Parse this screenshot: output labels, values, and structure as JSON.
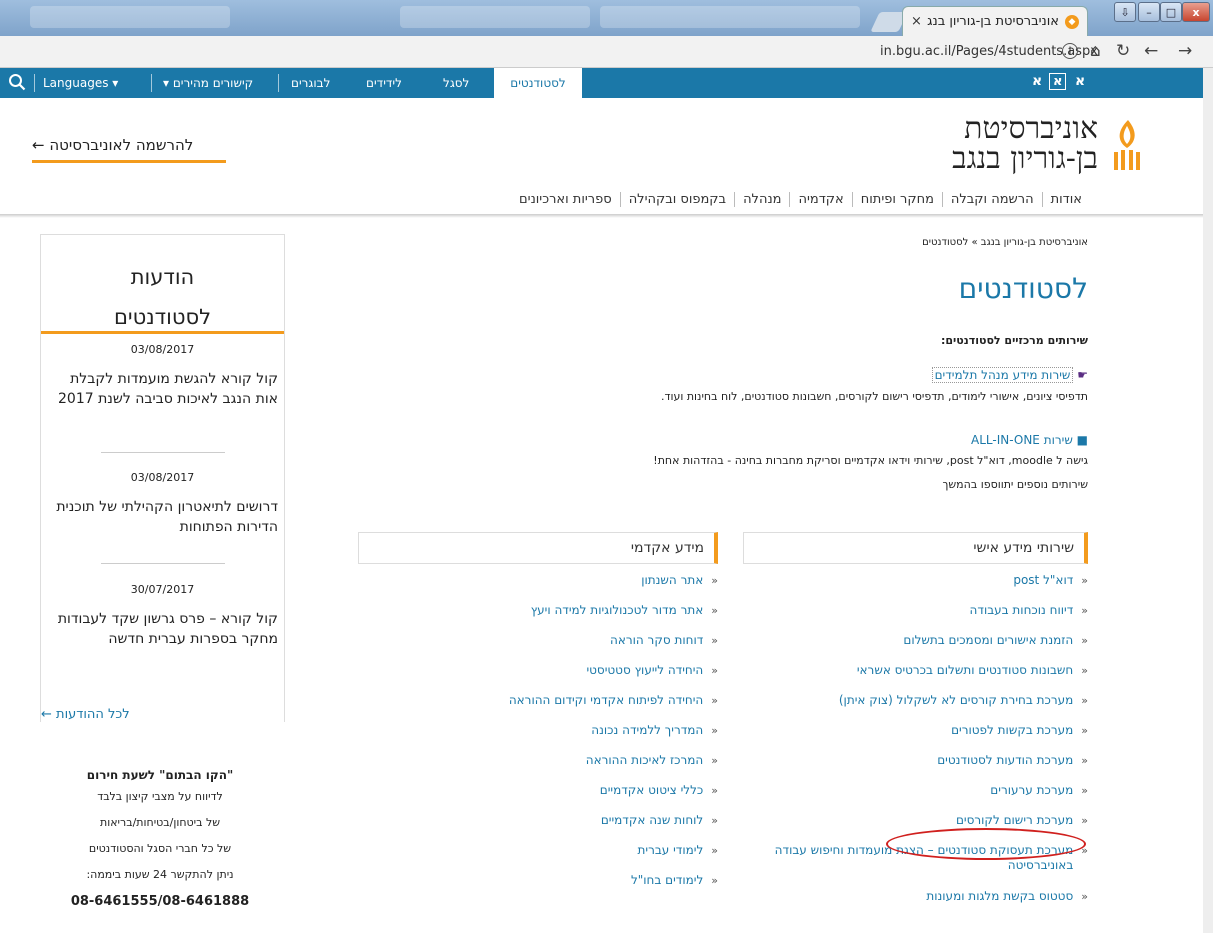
{
  "browser": {
    "tab_title": "אוניברסיטת בן-גוריון בנג",
    "tab_close": "×",
    "url": "in.bgu.ac.il/Pages/4students.aspx",
    "info_icon": "ⓘ",
    "nav_icons": {
      "home": "⌂",
      "reload": "↻",
      "back": "←",
      "forward": "→"
    },
    "window_buttons": {
      "minimize": "–",
      "maximize": "□",
      "close": "x",
      "extra": "⇩"
    }
  },
  "topnav": {
    "search_icon": "search-icon",
    "languages": "Languages ▾",
    "quick_links": "▾ קישורים מהירים",
    "items": [
      "לבוגרים",
      "לידידים",
      "לסגל"
    ],
    "students": "לסטודנטים",
    "accessibility": [
      "א",
      "א",
      "א"
    ]
  },
  "header": {
    "logo_line1": "אוניברסיטת",
    "logo_line2": "בן-גוריון בנגב",
    "register_link": "להרשמה לאוניברסיטה ←",
    "main_menu": [
      "אודות",
      "הרשמה וקבלה",
      "מחקר ופיתוח",
      "אקדמיה",
      "מנהלה",
      "בקמפוס ובקהילה",
      "ספריות וארכיונים"
    ]
  },
  "content": {
    "breadcrumb": "אוניברסיטת בן-גוריון בנגב » לסטודנטים",
    "title": "לסטודנטים",
    "services_heading": "שירותים מרכזיים לסטודנטים:",
    "service1_link": "שירות מידע מנהל תלמידים",
    "service1_desc": "תדפיסי ציונים, אישורי לימודים, תדפיסי רישום לקורסים, חשבונות סטודנטים, לוח בחינות ועוד.",
    "service2_link": "שירות ALL-IN-ONE",
    "service2_desc": "גישה ל moodle, דוא\"ל post, שירותי וידאו אקדמיים וסריקת מחברות בחינה - בהזדהות אחת!",
    "service2_note": "שירותים נוספים יתווספו בהמשך"
  },
  "personal": {
    "title": "שירותי מידע אישי",
    "items": [
      "דוא\"ל post",
      "דיווח נוכחות בעבודה",
      "הזמנת אישורים ומסמכים בתשלום",
      "חשבונות סטודנטים ותשלום בכרטיס אשראי",
      "מערכת בחירת קורסים לא לשקלול (צוק איתן)",
      "מערכת בקשות לפטורים",
      "מערכת הודעות לסטודנטים",
      "מערכת ערעורים",
      "מערכת רישום לקורסים",
      "מערכת תעסוקת סטודנטים – הצגת מועמדות וחיפוש עבודה באוניברסיטה",
      "סטטוס בקשת מלגות ומעונות"
    ]
  },
  "academic": {
    "title": "מידע אקדמי",
    "items": [
      "אתר השנתון",
      "אתר מדור לטכנולוגיות למידה ויעץ",
      "דוחות סקר הוראה",
      "היחידה לייעוץ סטטיסטי",
      "היחידה לפיתוח אקדמי וקידום ההוראה",
      "המדריך ללמידה נכונה",
      "המרכז לאיכות ההוראה",
      "כללי ציטוט אקדמיים",
      "לוחות שנה אקדמיים",
      "לימודי עברית",
      "לימודים בחו\"ל"
    ]
  },
  "sidebar": {
    "title_line1": "הודעות",
    "title_line2": "לסטודנטים",
    "news": [
      {
        "date": "03/08/2017",
        "text": "קול קורא להגשת מועמדות לקבלת אות הנגב לאיכות סביבה לשנת 2017"
      },
      {
        "date": "03/08/2017",
        "text": "דרושים לתיאטרון הקהילתי של תוכנית הדירות הפתוחות"
      },
      {
        "date": "30/07/2017",
        "text": "קול קורא – פרס גרשון שקד לעבודות מחקר בספרות עברית חדשה"
      }
    ],
    "all_news": "לכל ההודעות ←"
  },
  "hotline": {
    "title": "\"הקו הבתום\" לשעת חירום",
    "line1": "לדיווח על מצבי קיצון בלבד",
    "line2": "של ביטחון/בטיחות/בריאות",
    "line3": "של כל חברי הסגל והסטודנטים",
    "line4": "ניתן להתקשר 24 שעות ביממה:",
    "phones": "08-6461555/08-6461888"
  },
  "colors": {
    "brand_blue": "#1b78a8",
    "accent_orange": "#f39b1d",
    "annotation_red": "#d0201e"
  }
}
